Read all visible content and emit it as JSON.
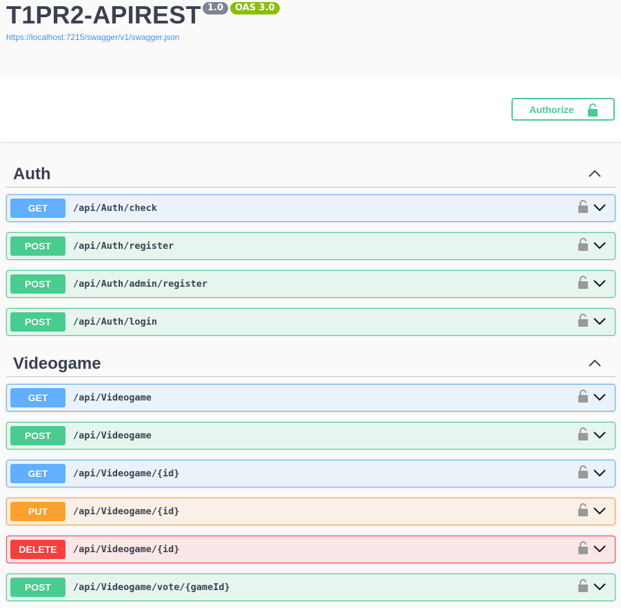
{
  "info": {
    "title": "T1PR2-APIREST",
    "version": "1.0",
    "oas": "OAS 3.0",
    "spec_url": "https://localhost:7215/swagger/v1/swagger.json"
  },
  "authorize": {
    "label": "Authorize"
  },
  "colors": {
    "get": "#61affe",
    "post": "#49cc90",
    "put": "#fca130",
    "delete": "#f93e3e"
  },
  "sections": [
    {
      "name": "Auth",
      "operations": [
        {
          "method": "GET",
          "path": "/api/Auth/check"
        },
        {
          "method": "POST",
          "path": "/api/Auth/register"
        },
        {
          "method": "POST",
          "path": "/api/Auth/admin/register"
        },
        {
          "method": "POST",
          "path": "/api/Auth/login"
        }
      ]
    },
    {
      "name": "Videogame",
      "operations": [
        {
          "method": "GET",
          "path": "/api/Videogame"
        },
        {
          "method": "POST",
          "path": "/api/Videogame"
        },
        {
          "method": "GET",
          "path": "/api/Videogame/{id}"
        },
        {
          "method": "PUT",
          "path": "/api/Videogame/{id}"
        },
        {
          "method": "DELETE",
          "path": "/api/Videogame/{id}"
        },
        {
          "method": "POST",
          "path": "/api/Videogame/vote/{gameId}"
        }
      ]
    }
  ],
  "icons": {
    "lock": "lock-icon",
    "unlock": "unlock-icon",
    "chevron_up": "chevron-up-icon",
    "chevron_down": "chevron-down-icon"
  }
}
